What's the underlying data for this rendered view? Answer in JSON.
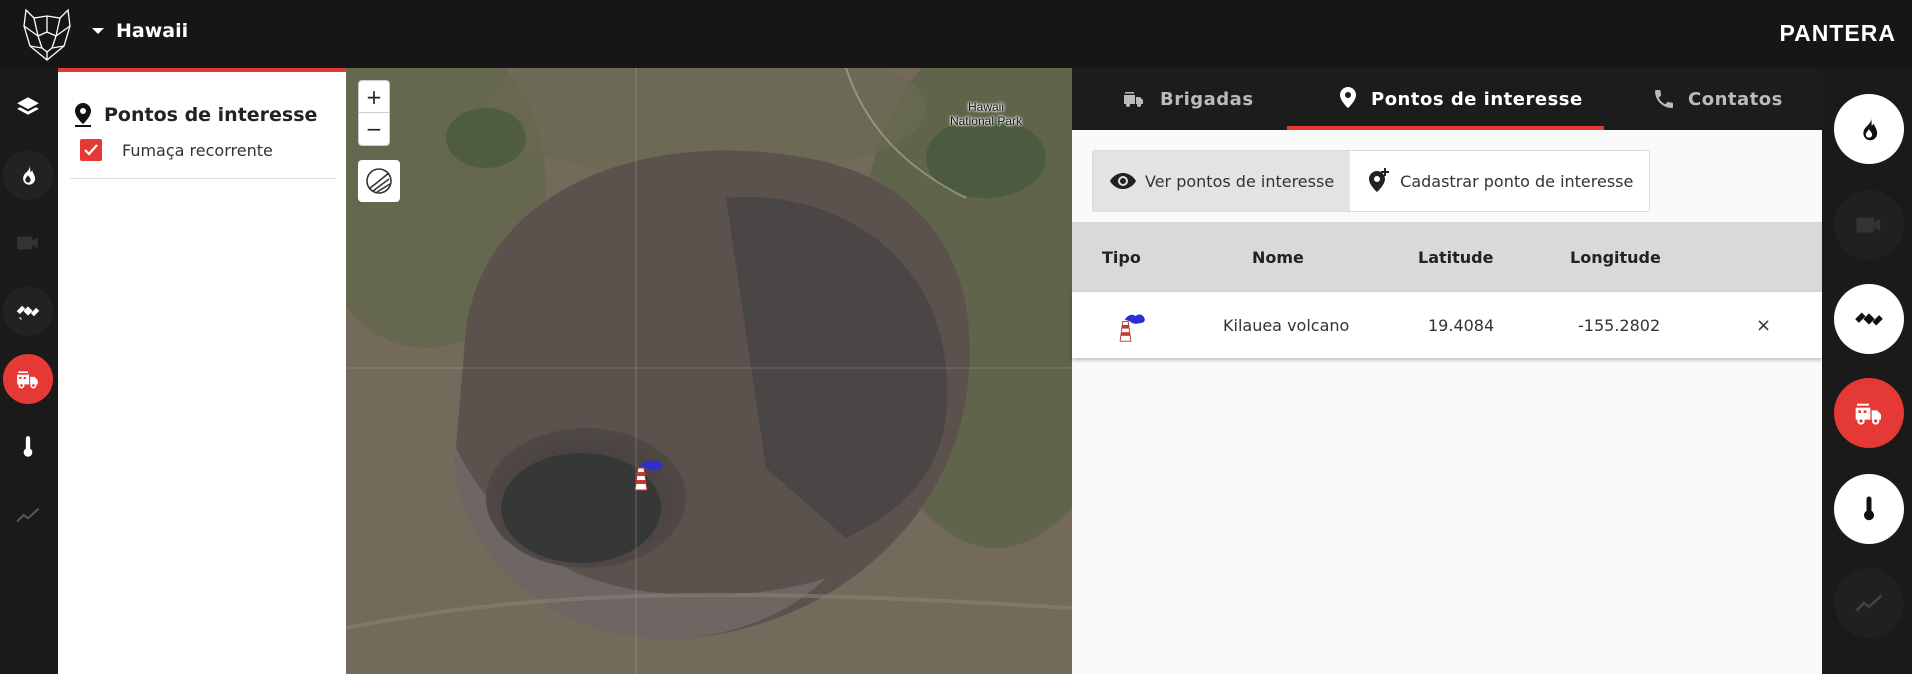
{
  "header": {
    "region": "Hawaii",
    "brand": "PANTERA"
  },
  "left_rail": {
    "items": [
      {
        "icon": "layers-icon"
      },
      {
        "icon": "fire-icon"
      },
      {
        "icon": "camera-icon"
      },
      {
        "icon": "satellite-icon"
      },
      {
        "icon": "fire-truck-icon",
        "active": true
      },
      {
        "icon": "thermometer-icon"
      },
      {
        "icon": "chart-line-icon"
      }
    ]
  },
  "layers_panel": {
    "title": "Pontos de interesse",
    "items": [
      {
        "label": "Fumaça recorrente",
        "checked": true
      }
    ]
  },
  "map": {
    "zoom_in": "+",
    "zoom_out": "−",
    "park_label": "Hawaii National Park"
  },
  "poi_panel": {
    "tabs": [
      {
        "label": "Brigadas"
      },
      {
        "label": "Pontos de interesse",
        "active": true
      },
      {
        "label": "Contatos"
      }
    ],
    "toggle": {
      "view_label": "Ver pontos de interesse",
      "add_label": "Cadastrar ponto de interesse"
    },
    "table": {
      "headers": {
        "type": "Tipo",
        "name": "Nome",
        "lat": "Latitude",
        "lon": "Longitude"
      },
      "rows": [
        {
          "type_icon": "smoke-chimney-icon",
          "name": "Kilauea volcano",
          "lat": "19.4084",
          "lon": "-155.2802",
          "remove": "×"
        }
      ]
    }
  },
  "right_rail": {
    "items": [
      {
        "icon": "fire-icon",
        "style": "white"
      },
      {
        "icon": "camera-icon",
        "style": "dark"
      },
      {
        "icon": "satellite-icon",
        "style": "white"
      },
      {
        "icon": "fire-truck-icon",
        "style": "red"
      },
      {
        "icon": "thermometer-icon",
        "style": "white"
      },
      {
        "icon": "chart-line-icon",
        "style": "dark"
      }
    ]
  },
  "colors": {
    "accent": "#e53935",
    "topbar": "#161616",
    "table_header": "#d9d9d9"
  }
}
